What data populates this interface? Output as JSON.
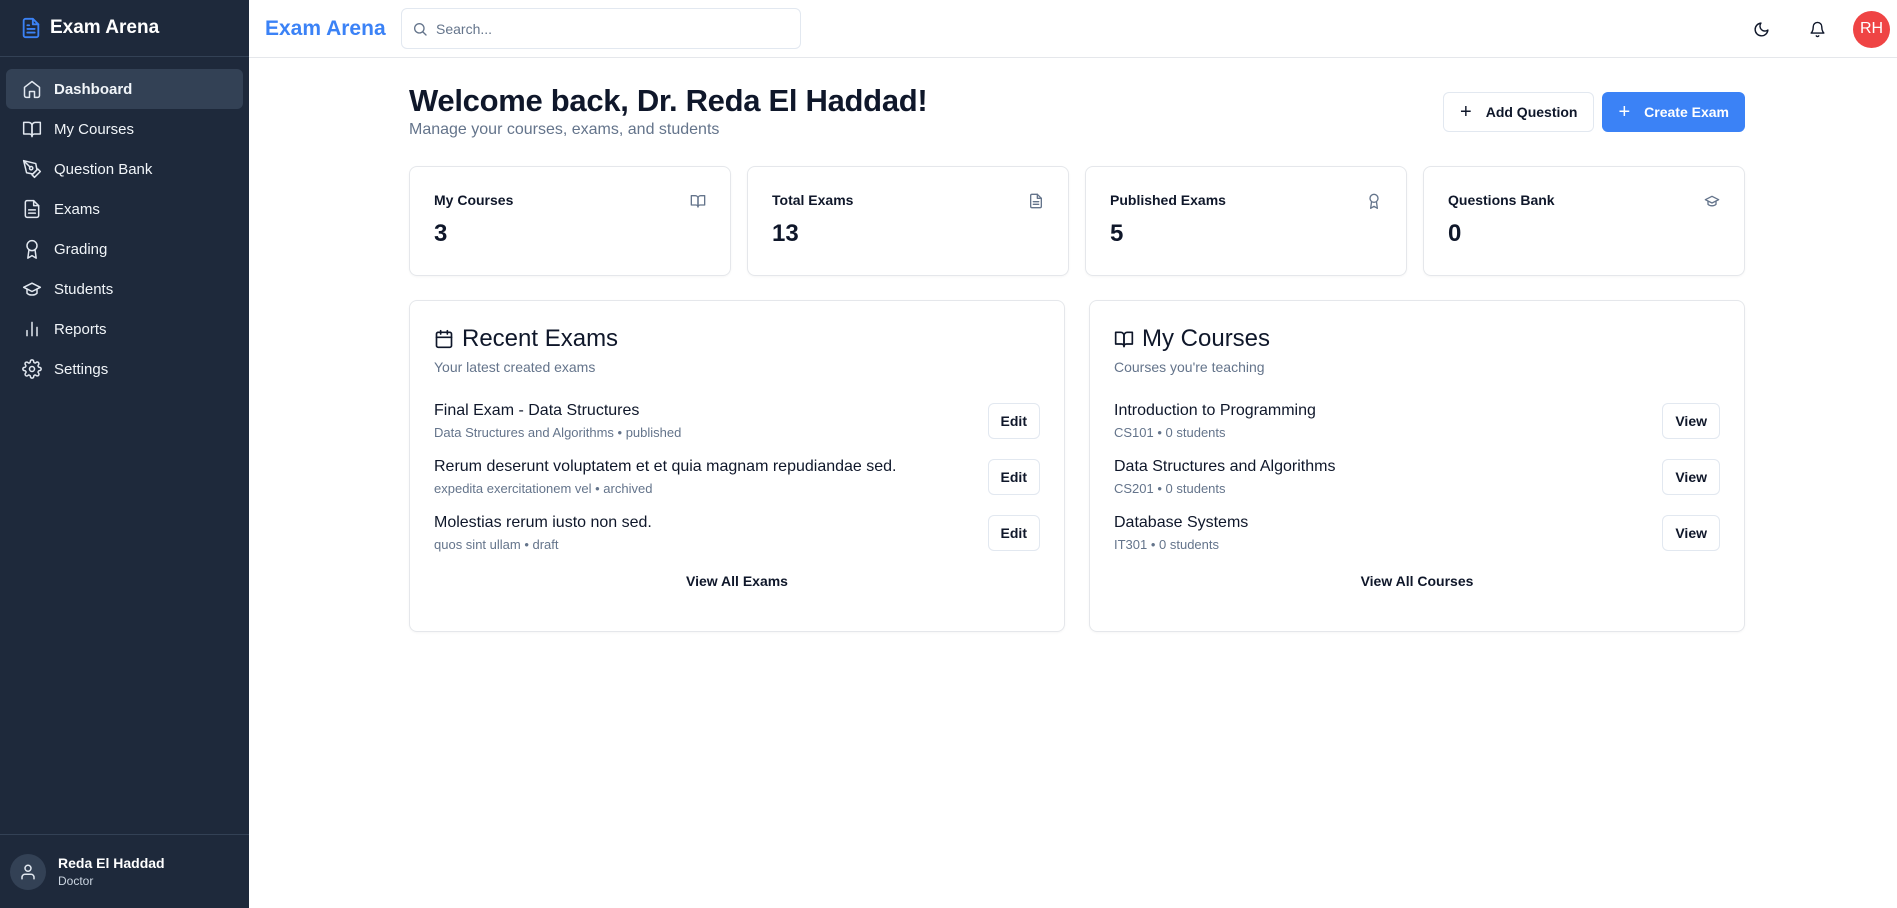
{
  "app": {
    "name": "Exam Arena"
  },
  "sidebar": {
    "items": [
      {
        "label": "Dashboard",
        "icon": "home-icon",
        "active": true
      },
      {
        "label": "My Courses",
        "icon": "book-icon"
      },
      {
        "label": "Question Bank",
        "icon": "pen-icon"
      },
      {
        "label": "Exams",
        "icon": "file-icon"
      },
      {
        "label": "Grading",
        "icon": "award-icon"
      },
      {
        "label": "Students",
        "icon": "graduation-cap-icon"
      },
      {
        "label": "Reports",
        "icon": "bar-chart-icon"
      },
      {
        "label": "Settings",
        "icon": "gear-icon"
      }
    ],
    "user": {
      "name": "Reda El Haddad",
      "role": "Doctor"
    }
  },
  "topbar": {
    "brand": "Exam Arena",
    "search_placeholder": "Search...",
    "avatar_initials": "RH",
    "avatar_color": "#ef4444"
  },
  "welcome": {
    "title": "Welcome back, Dr. Reda El Haddad!",
    "subtitle": "Manage your courses, exams, and students"
  },
  "actions": {
    "add_question": "Add Question",
    "create_exam": "Create Exam"
  },
  "stats": [
    {
      "label": "My Courses",
      "value": "3",
      "icon": "book-icon"
    },
    {
      "label": "Total Exams",
      "value": "13",
      "icon": "file-icon"
    },
    {
      "label": "Published Exams",
      "value": "5",
      "icon": "award-icon"
    },
    {
      "label": "Questions Bank",
      "value": "0",
      "icon": "graduation-cap-icon"
    }
  ],
  "recent_exams": {
    "title": "Recent Exams",
    "subtitle": "Your latest created exams",
    "action_label": "Edit",
    "items": [
      {
        "title": "Final Exam - Data Structures",
        "meta": "Data Structures and Algorithms • published"
      },
      {
        "title": "Rerum deserunt voluptatem et et quia magnam repudiandae sed.",
        "meta": "expedita exercitationem vel • archived"
      },
      {
        "title": "Molestias rerum iusto non sed.",
        "meta": "quos sint ullam • draft"
      }
    ],
    "view_all": "View All Exams"
  },
  "my_courses": {
    "title": "My Courses",
    "subtitle": "Courses you're teaching",
    "action_label": "View",
    "items": [
      {
        "title": "Introduction to Programming",
        "meta": "CS101 • 0 students"
      },
      {
        "title": "Data Structures and Algorithms",
        "meta": "CS201 • 0 students"
      },
      {
        "title": "Database Systems",
        "meta": "IT301 • 0 students"
      }
    ],
    "view_all": "View All Courses"
  },
  "colors": {
    "sidebar_bg": "#1e293b",
    "accent": "#3b82f6"
  }
}
